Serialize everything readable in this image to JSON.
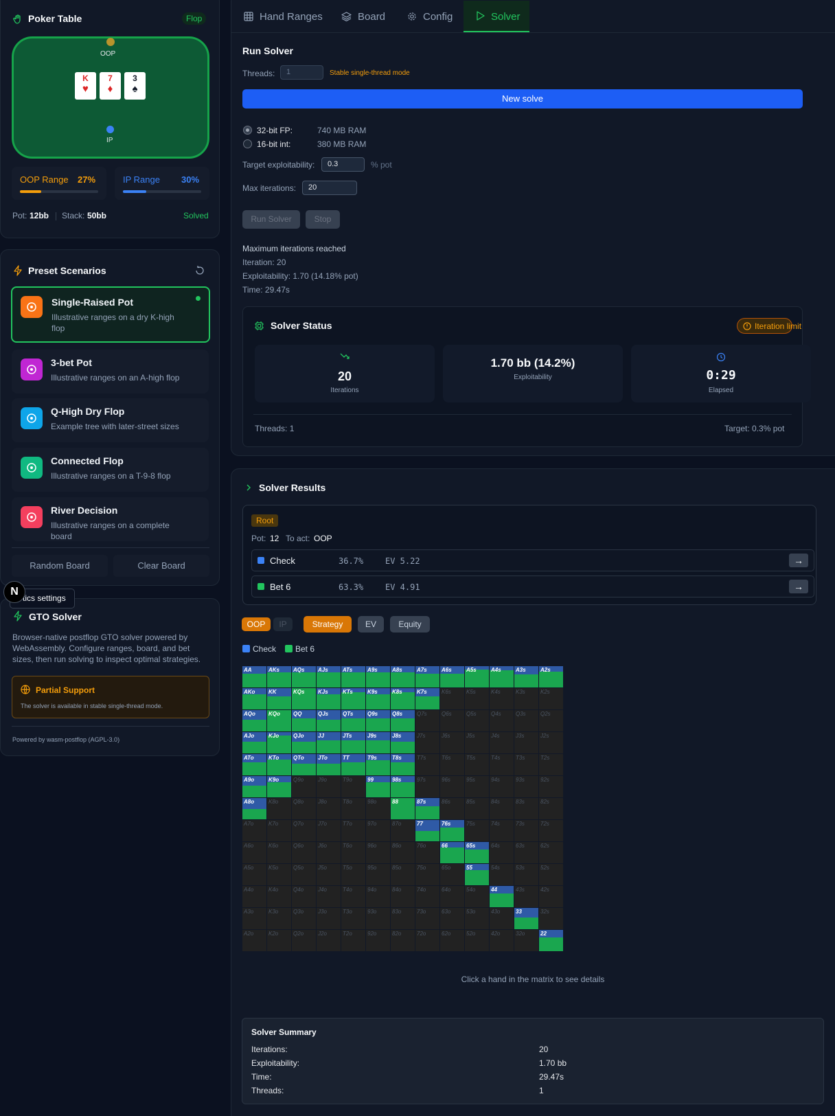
{
  "table": {
    "title": "Poker Table",
    "street": "Flop",
    "oop_label": "OOP",
    "ip_label": "IP",
    "cards": [
      {
        "rank": "K",
        "suit": "♥",
        "color": "#dc2626"
      },
      {
        "rank": "7",
        "suit": "♦",
        "color": "#dc2626"
      },
      {
        "rank": "3",
        "suit": "♠",
        "color": "#111827"
      }
    ],
    "oop_range_label": "OOP Range",
    "oop_range_pct": "27%",
    "oop_range_value": 0.27,
    "ip_range_label": "IP Range",
    "ip_range_pct": "30%",
    "ip_range_value": 0.3,
    "pot_label": "Pot:",
    "pot_value": "12bb",
    "stack_label": "Stack:",
    "stack_value": "50bb",
    "status": "Solved"
  },
  "presets": {
    "title": "Preset Scenarios",
    "items": [
      {
        "title": "Single-Raised Pot",
        "desc": "Illustrative ranges on a dry K-high flop",
        "color": "#f97316"
      },
      {
        "title": "3-bet Pot",
        "desc": "Illustrative ranges on an A-high flop",
        "color": "#c026d3"
      },
      {
        "title": "Q-High Dry Flop",
        "desc": "Example tree with later-street sizes",
        "color": "#0ea5e9"
      },
      {
        "title": "Connected Flop",
        "desc": "Illustrative ranges on a T-9-8 flop",
        "color": "#10b981"
      },
      {
        "title": "River Decision",
        "desc": "Illustrative ranges on a complete board",
        "color": "#f43f5e"
      }
    ],
    "random_board": "Random Board",
    "clear_board": "Clear Board"
  },
  "about": {
    "tooltip": "tics settings",
    "avatar": "N",
    "title": "GTO Solver",
    "desc": "Browser-native postflop GTO solver powered by WebAssembly. Configure ranges, board, and bet sizes, then run solving to inspect optimal strategies.",
    "support_title": "Partial Support",
    "support_desc": "The solver is available in stable single-thread mode.",
    "powered": "Powered by wasm-postflop (AGPL-3.0)"
  },
  "tabs": [
    "Hand Ranges",
    "Board",
    "Config",
    "Solver"
  ],
  "run": {
    "title": "Run Solver",
    "threads_label": "Threads:",
    "threads_value": "1",
    "threads_note": "Stable single-thread mode",
    "new_solve": "New solve",
    "fp32_label": "32-bit FP:",
    "fp32_ram": "740 MB RAM",
    "int16_label": "16-bit int:",
    "int16_ram": "380 MB RAM",
    "target_label": "Target exploitability:",
    "target_value": "0.3",
    "target_unit": "% pot",
    "max_iter_label": "Max iterations:",
    "max_iter_value": "20",
    "run_btn": "Run Solver",
    "stop_btn": "Stop",
    "log": [
      "Maximum iterations reached",
      "Iteration: 20",
      "Exploitability: 1.70 (14.18% pot)",
      "Time: 29.47s"
    ]
  },
  "status": {
    "title": "Solver Status",
    "badge": "Iteration limit",
    "iterations": "20",
    "iterations_label": "Iterations",
    "exploit": "1.70 bb (14.2%)",
    "exploit_label": "Exploitability",
    "elapsed": "0:29",
    "elapsed_label": "Elapsed",
    "threads": "Threads: 1",
    "target": "Target: 0.3% pot"
  },
  "results": {
    "title": "Solver Results",
    "node": "Root",
    "pot_label": "Pot:",
    "pot": "12",
    "to_act_label": "To act:",
    "to_act": "OOP",
    "actions": [
      {
        "name": "Check",
        "pct": "36.7%",
        "ev": "EV 5.22",
        "color": "#3b82f6"
      },
      {
        "name": "Bet 6",
        "pct": "63.3%",
        "ev": "EV 4.91",
        "color": "#22c55e"
      }
    ],
    "arrow": "→",
    "player_oop": "OOP",
    "player_ip": "IP",
    "view_strategy": "Strategy",
    "view_ev": "EV",
    "view_equity": "Equity",
    "legend": [
      {
        "name": "Check",
        "color": "#3b82f6"
      },
      {
        "name": "Bet 6",
        "color": "#22c55e"
      }
    ],
    "hint": "Click a hand in the matrix to see details"
  },
  "summary": {
    "title": "Solver Summary",
    "rows": [
      {
        "k": "Iterations:",
        "v": "20"
      },
      {
        "k": "Exploitability:",
        "v": "1.70 bb"
      },
      {
        "k": "Time:",
        "v": "29.47s"
      },
      {
        "k": "Threads:",
        "v": "1"
      }
    ]
  },
  "matrix": {
    "ranks": [
      "A",
      "K",
      "Q",
      "J",
      "T",
      "9",
      "8",
      "7",
      "6",
      "5",
      "4",
      "3",
      "2"
    ],
    "check_freq": [
      [
        0.35,
        0.3,
        0.3,
        0.3,
        0.3,
        0.3,
        0.3,
        0.35,
        0.35,
        0.15,
        0.2,
        0.4,
        0.25
      ],
      [
        0.3,
        0.4,
        0.0,
        0.3,
        0.2,
        0.3,
        0.2,
        0.4,
        null,
        null,
        null,
        null,
        null
      ],
      [
        0.45,
        0.0,
        0.4,
        0.45,
        0.4,
        0.4,
        0.4,
        null,
        null,
        null,
        null,
        null,
        null
      ],
      [
        0.45,
        0.15,
        0.45,
        0.4,
        0.4,
        0.4,
        0.45,
        null,
        null,
        null,
        null,
        null,
        null
      ],
      [
        0.4,
        0.25,
        0.45,
        0.45,
        0.4,
        0.3,
        0.4,
        null,
        null,
        null,
        null,
        null,
        null
      ],
      [
        0.45,
        0.3,
        null,
        null,
        null,
        0.3,
        0.3,
        null,
        null,
        null,
        null,
        null,
        null
      ],
      [
        0.5,
        null,
        null,
        null,
        null,
        null,
        0.0,
        0.4,
        null,
        null,
        null,
        null,
        null
      ],
      [
        null,
        null,
        null,
        null,
        null,
        null,
        null,
        0.5,
        0.35,
        null,
        null,
        null,
        null
      ],
      [
        null,
        null,
        null,
        null,
        null,
        null,
        null,
        null,
        0.25,
        0.35,
        null,
        null,
        null
      ],
      [
        null,
        null,
        null,
        null,
        null,
        null,
        null,
        null,
        null,
        0.3,
        null,
        null,
        null
      ],
      [
        null,
        null,
        null,
        null,
        null,
        null,
        null,
        null,
        null,
        null,
        0.35,
        null,
        null
      ],
      [
        null,
        null,
        null,
        null,
        null,
        null,
        null,
        null,
        null,
        null,
        null,
        0.45,
        null
      ],
      [
        null,
        null,
        null,
        null,
        null,
        null,
        null,
        null,
        null,
        null,
        null,
        null,
        0.35
      ]
    ]
  }
}
